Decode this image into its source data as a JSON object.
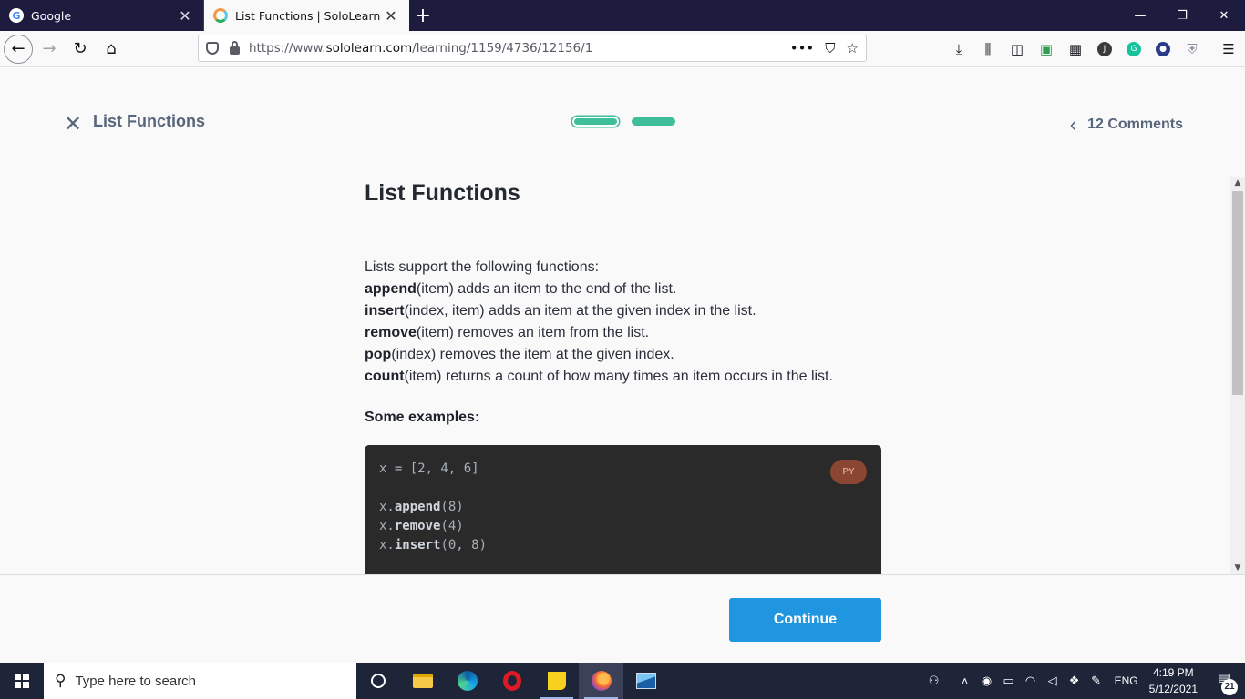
{
  "browser": {
    "tabs": [
      {
        "title": "Google",
        "active": false,
        "favicon": "google-icon"
      },
      {
        "title": "List Functions | SoloLearn",
        "active": true,
        "favicon": "sololearn-icon"
      }
    ],
    "url_prefix": "https://www.",
    "url_domain": "sololearn.com",
    "url_path": "/learning/1159/4736/12156/1"
  },
  "header": {
    "close_icon": "✕",
    "lesson_name": "List Functions",
    "comments_label": "12 Comments",
    "progress": {
      "total_steps": 2,
      "current_step": 1
    }
  },
  "lesson": {
    "title": "List Functions",
    "intro": "Lists support the following functions:",
    "functions": [
      {
        "name": "append",
        "desc": "(item) adds an item to the end of the list."
      },
      {
        "name": "insert",
        "desc": "(index, item) adds an item at the given index in the list."
      },
      {
        "name": "remove",
        "desc": "(item) removes an item from the list."
      },
      {
        "name": "pop",
        "desc": "(index) removes the item at the given index."
      },
      {
        "name": "count",
        "desc": "(item) returns a count of how many times an item occurs in the list."
      }
    ],
    "examples_heading": "Some examples:",
    "code": {
      "language_badge": "PY",
      "line1": "x = [2, 4, 6]",
      "l2_pre": "x.",
      "l2_kw": "append",
      "l2_post": "(8)",
      "l3_pre": "x.",
      "l3_kw": "remove",
      "l3_post": "(4)",
      "l4_pre": "x.",
      "l4_kw": "insert",
      "l4_post": "(0, 8)"
    }
  },
  "footer": {
    "continue_label": "Continue"
  },
  "taskbar": {
    "search_placeholder": "Type here to search",
    "language": "ENG",
    "time": "4:19 PM",
    "date": "5/12/2021",
    "notification_count": "21"
  },
  "colors": {
    "accent_green": "#3fbe9a",
    "continue_blue": "#2196e0",
    "code_bg": "#2a2a2a",
    "badge_py": "#8a4533"
  }
}
